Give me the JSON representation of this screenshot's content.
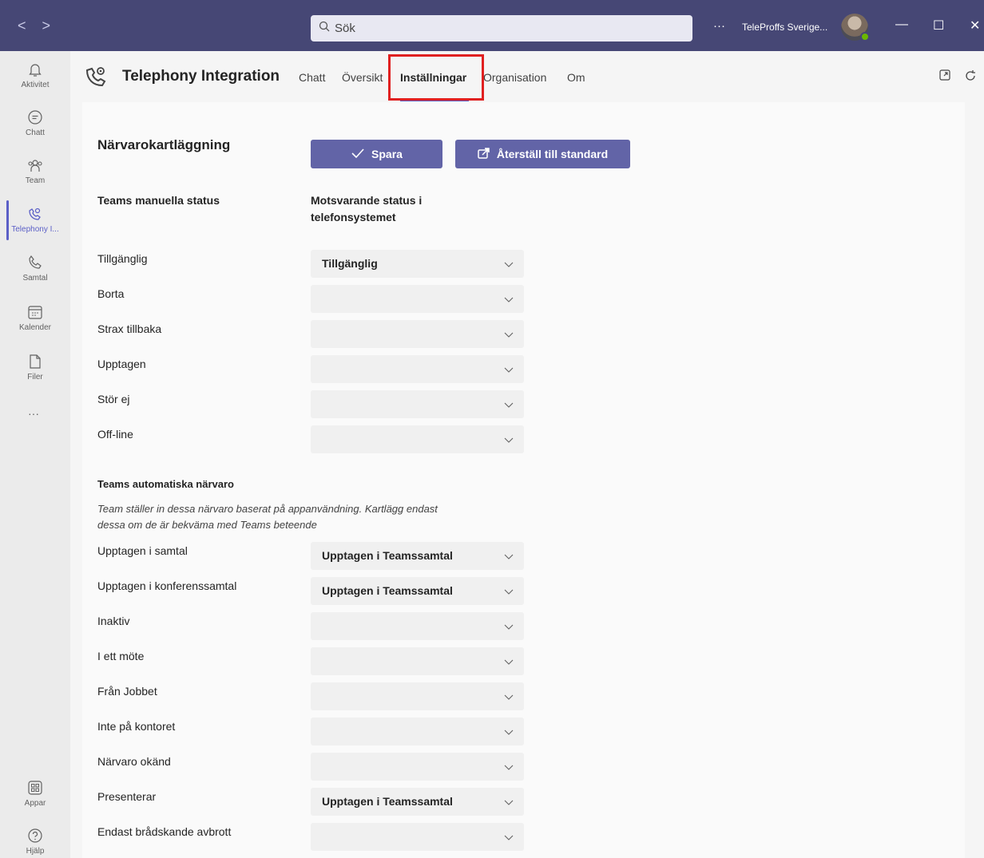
{
  "titlebar": {
    "search_placeholder": "Sök",
    "more": "···",
    "org_name": "TeleProffs Sverige...",
    "minimize": "—",
    "maximize": "☐",
    "close": "✕"
  },
  "rail": {
    "items": [
      {
        "label": "Aktivitet"
      },
      {
        "label": "Chatt"
      },
      {
        "label": "Team"
      },
      {
        "label": "Telephony I..."
      },
      {
        "label": "Samtal"
      },
      {
        "label": "Kalender"
      },
      {
        "label": "Filer"
      },
      {
        "label": "Appar"
      },
      {
        "label": "Hjälp"
      }
    ],
    "more": "···"
  },
  "app": {
    "title": "Telephony Integration",
    "tabs": [
      {
        "label": "Chatt"
      },
      {
        "label": "Översikt"
      },
      {
        "label": "Inställningar"
      },
      {
        "label": "Organisation"
      },
      {
        "label": "Om"
      }
    ]
  },
  "settings": {
    "section_title": "Närvarokartläggning",
    "save_label": "Spara",
    "reset_label": "Återställ till standard",
    "col_left": "Teams manuella status",
    "col_right_1": "Motsvarande status i",
    "col_right_2": "telefonsystemet",
    "manual_rows": [
      {
        "label": "Tillgänglig",
        "value": "Tillgänglig"
      },
      {
        "label": "Borta",
        "value": ""
      },
      {
        "label": "Strax tillbaka",
        "value": ""
      },
      {
        "label": "Upptagen",
        "value": ""
      },
      {
        "label": "Stör ej",
        "value": ""
      },
      {
        "label": "Off-line",
        "value": ""
      }
    ],
    "auto_title": "Teams automatiska närvaro",
    "auto_desc_1": "Team ställer in dessa närvaro baserat på appanvändning. Kartlägg endast",
    "auto_desc_2": "dessa om de är bekväma med Teams beteende",
    "auto_rows": [
      {
        "label": "Upptagen i samtal",
        "value": "Upptagen i Teamssamtal"
      },
      {
        "label": "Upptagen i konferenssamtal",
        "value": "Upptagen i Teamssamtal"
      },
      {
        "label": "Inaktiv",
        "value": ""
      },
      {
        "label": "I ett möte",
        "value": ""
      },
      {
        "label": "Från Jobbet",
        "value": ""
      },
      {
        "label": "Inte på kontoret",
        "value": ""
      },
      {
        "label": "Närvaro okänd",
        "value": ""
      },
      {
        "label": "Presenterar",
        "value": "Upptagen i Teamssamtal"
      },
      {
        "label": "Endast brådskande avbrott",
        "value": ""
      }
    ]
  },
  "colors": {
    "titlebar": "#464775",
    "accent": "#6264a7",
    "highlight": "#e02020"
  }
}
